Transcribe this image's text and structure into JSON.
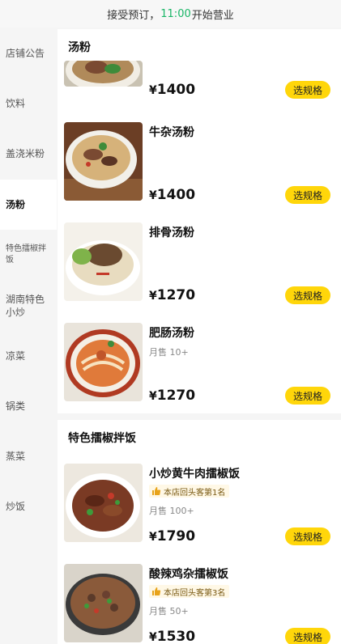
{
  "banner": {
    "prefix": "接受预订，",
    "time": "11:00",
    "suffix": "开始营业"
  },
  "sidebar": {
    "items": [
      {
        "label": "店铺公告"
      },
      {
        "label": "饮料"
      },
      {
        "label": "盖浇米粉"
      },
      {
        "label": "汤粉",
        "active": true
      },
      {
        "label": "特色擂椒拌饭"
      },
      {
        "label": "湖南特色小炒"
      },
      {
        "label": "凉菜"
      },
      {
        "label": "锅类"
      },
      {
        "label": "蒸菜"
      },
      {
        "label": "炒饭"
      }
    ]
  },
  "sections": [
    {
      "title": "汤粉",
      "items": [
        {
          "name": "",
          "price": "1400",
          "button": "选规格",
          "icon": "noodle-soup-bowl"
        },
        {
          "name": "牛杂汤粉",
          "price": "1400",
          "button": "选规格",
          "icon": "beef-offal-noodles"
        },
        {
          "name": "排骨汤粉",
          "price": "1270",
          "button": "选规格",
          "icon": "pork-rib-noodles"
        },
        {
          "name": "肥肠汤粉",
          "sales": "月售 10+",
          "price": "1270",
          "button": "选规格",
          "icon": "pork-intestine-noodles"
        }
      ]
    },
    {
      "title": "特色擂椒拌饭",
      "items": [
        {
          "name": "小炒黄牛肉擂椒饭",
          "badge": "本店回头客第1名",
          "sales": "月售 100+",
          "price": "1790",
          "button": "选规格",
          "icon": "stir-fried-beef-rice"
        },
        {
          "name": "酸辣鸡杂擂椒饭",
          "badge": "本店回头客第3名",
          "sales": "月售 50+",
          "price": "1530",
          "button": "选规格",
          "icon": "chicken-giblets-rice"
        }
      ]
    }
  ],
  "currency": "¥",
  "colors": {
    "accent_yellow": "#ffd60a",
    "time_green": "#18b566",
    "badge_bg": "#fff8e6"
  }
}
